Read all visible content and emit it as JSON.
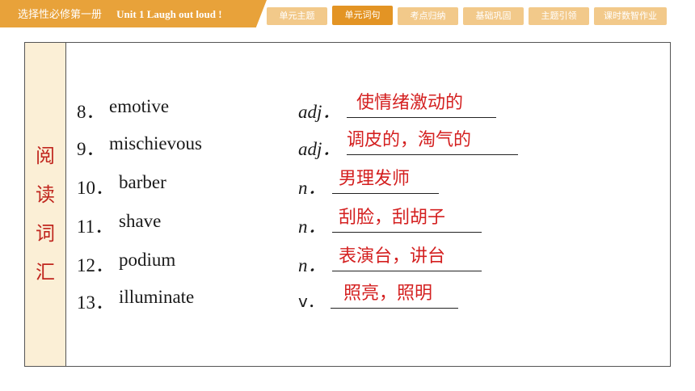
{
  "header": {
    "title_cn": "选择性必修第一册",
    "title_en": "Unit 1    Laugh out loud !"
  },
  "tabs": [
    {
      "label": "单元主题"
    },
    {
      "label": "单元词句"
    },
    {
      "label": "考点归纳"
    },
    {
      "label": "基础巩固"
    },
    {
      "label": "主题引领"
    },
    {
      "label": "课时数智作业"
    }
  ],
  "active_tab": "单元词句",
  "section_label": [
    "阅",
    "读",
    "词",
    "汇"
  ],
  "items": [
    {
      "num": "8．",
      "word": "emotive",
      "pos": "adj．",
      "answer": "使情绪激动的"
    },
    {
      "num": "9．",
      "word": "mischievous",
      "pos": "adj．",
      "answer": "调皮的，淘气的"
    },
    {
      "num": "10．",
      "word": "barber",
      "pos": "n．",
      "answer": "男理发师"
    },
    {
      "num": "11．",
      "word": "shave",
      "pos": "n．",
      "answer": "刮脸，刮胡子"
    },
    {
      "num": "12．",
      "word": "podium",
      "pos": "n．",
      "answer": "表演台，讲台"
    },
    {
      "num": "13．",
      "word": "illuminate",
      "pos": "v．",
      "answer": "照亮，照明"
    }
  ]
}
